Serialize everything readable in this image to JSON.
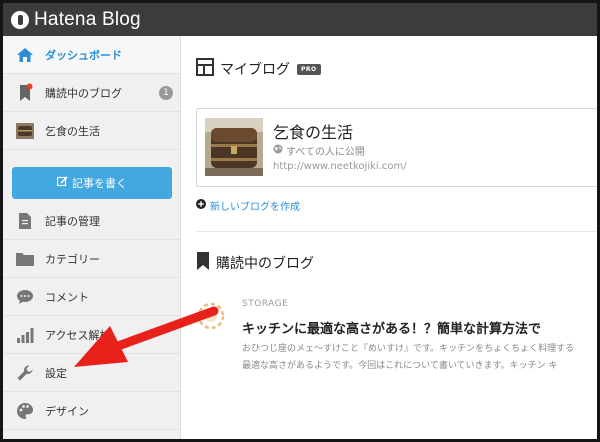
{
  "header": {
    "logo_text": "Hatena Blog"
  },
  "sidebar": {
    "items": [
      {
        "label": "ダッシュボード",
        "icon": "home-icon"
      },
      {
        "label": "購読中のブログ",
        "icon": "bookmark-icon",
        "badge": "1"
      },
      {
        "label": "乞食の生活",
        "icon": "blog-thumbnail-icon"
      },
      {
        "label": "記事の管理",
        "icon": "document-icon"
      },
      {
        "label": "カテゴリー",
        "icon": "folder-icon"
      },
      {
        "label": "コメント",
        "icon": "comment-icon"
      },
      {
        "label": "アクセス解析",
        "icon": "bar-chart-icon"
      },
      {
        "label": "設定",
        "icon": "wrench-icon"
      },
      {
        "label": "デザイン",
        "icon": "palette-icon"
      }
    ],
    "write_button": "記事を書く"
  },
  "main": {
    "my_blogs_title": "マイブログ",
    "pro_badge": "PRO",
    "blog": {
      "name": "乞食の生活",
      "visibility": "すべての人に公開",
      "url": "http://www.neetkojiki.com/"
    },
    "new_blog_link": "新しいブログを作成",
    "subscribed_title": "購読中のブログ",
    "story": {
      "source": "STORAGE",
      "title": "キッチンに最適な高さがある！？簡単な計算方法で",
      "body_line1": "おひつじ座のメェ〜すけこと『めいすけ』です。キッチンをちょくちょく料理する",
      "body_line2": "最適な高さがあるようです。今回はこれについて書いていきます。キッチン キ"
    }
  },
  "colors": {
    "accent": "#2a8fd6",
    "button": "#43a8e0",
    "annotation_arrow": "#e8211b"
  }
}
